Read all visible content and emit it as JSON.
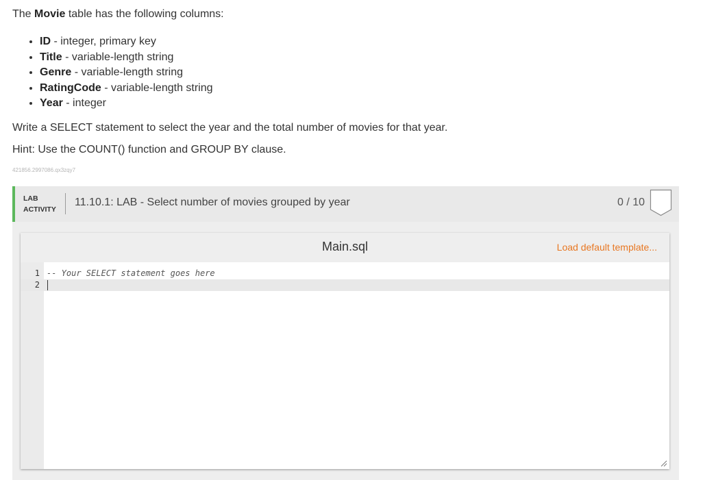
{
  "intro": {
    "prefix": "The",
    "table_name": "Movie",
    "suffix": "table has the following columns:"
  },
  "columns": [
    {
      "name": "ID",
      "desc": "- integer, primary key"
    },
    {
      "name": "Title",
      "desc": "- variable-length string"
    },
    {
      "name": "Genre",
      "desc": "- variable-length string"
    },
    {
      "name": "RatingCode",
      "desc": "- variable-length string"
    },
    {
      "name": "Year",
      "desc": "- integer"
    }
  ],
  "task": "Write a SELECT statement to select the year and the total number of movies for that year.",
  "hint": "Hint: Use the COUNT() function and GROUP BY clause.",
  "tiny_id": "421856.2997086.qx3zqy7",
  "lab": {
    "badge_line1": "LAB",
    "badge_line2": "ACTIVITY",
    "title": "11.10.1: LAB - Select number of movies grouped by year",
    "score": "0 / 10",
    "accent_color": "#5cb85c"
  },
  "editor": {
    "file_name": "Main.sql",
    "load_template": "Load default template...",
    "lines": [
      {
        "num": "1",
        "code": "-- Your SELECT statement goes here"
      },
      {
        "num": "2",
        "code": ""
      }
    ]
  }
}
